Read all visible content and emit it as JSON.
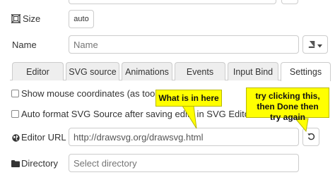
{
  "size": {
    "label": "Size",
    "value": "auto"
  },
  "name": {
    "label": "Name",
    "placeholder": "Name"
  },
  "tabs": [
    {
      "label": "Editor"
    },
    {
      "label": "SVG source"
    },
    {
      "label": "Animations"
    },
    {
      "label": "Events"
    },
    {
      "label": "Input Bind"
    },
    {
      "label": "Settings"
    }
  ],
  "active_tab": "Settings",
  "settings": {
    "show_mouse_coords": {
      "label": "Show mouse coordinates (as tooltip)",
      "checked": false
    },
    "auto_format": {
      "label": "Auto format SVG Source after saving edits in SVG Editor",
      "checked": false
    },
    "editor_url": {
      "label": "Editor URL",
      "value": "http://drawsvg.org/drawsvg.html"
    },
    "directory": {
      "label": "Directory",
      "placeholder": "Select directory"
    }
  },
  "annotations": {
    "left": "What is in here",
    "right": "try clicking this, then Done then try again"
  },
  "colors": {
    "callout": "#ffff00",
    "border": "#cccccc",
    "tab_inactive": "#eeeeee"
  },
  "icons": [
    "size-icon",
    "book-icon",
    "caret-down-icon",
    "globe-icon",
    "refresh-icon",
    "folder-icon"
  ]
}
